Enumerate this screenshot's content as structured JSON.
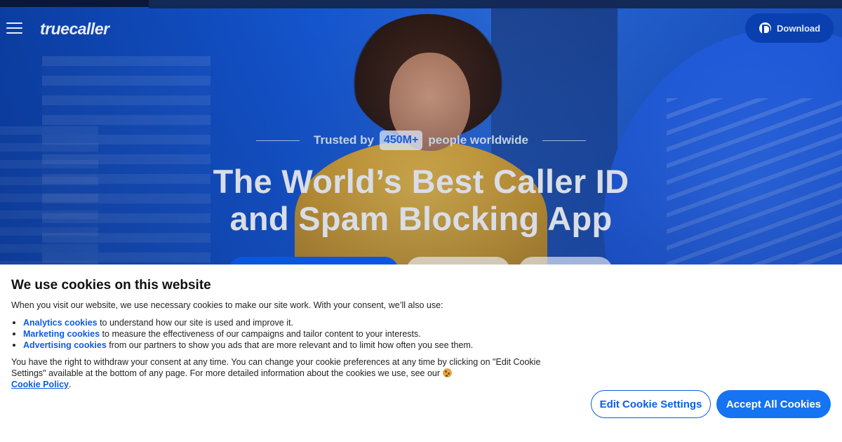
{
  "header": {
    "logo_text": "truecaller",
    "download_label": "Download"
  },
  "hero": {
    "trusted_prefix": "Trusted by",
    "trusted_count": "450M+",
    "trusted_suffix": "people worldwide",
    "headline_line1": "The World’s Best Caller ID",
    "headline_line2": "and Spam Blocking App"
  },
  "cookie_banner": {
    "title": "We use cookies on this website",
    "intro": "When you visit our website, we use necessary cookies to make our site work. With your consent, we’ll also use:",
    "items": [
      {
        "link": "Analytics cookies",
        "text": " to understand how our site is used and improve it."
      },
      {
        "link": "Marketing cookies",
        "text": " to measure the effectiveness of our campaigns and tailor content to your interests."
      },
      {
        "link": "Advertising cookies",
        "text": " from our partners to show you ads that are more relevant and to limit how often you see them."
      }
    ],
    "rights_text": "You have the right to withdraw your consent at any time. You can change your cookie preferences at any time by clicking on \"Edit Cookie Settings\" available at the bottom of any page. For more detailed information about the cookies we use, see our",
    "policy_link": "Cookie Policy",
    "policy_suffix": ".",
    "edit_label": "Edit Cookie Settings",
    "accept_label": "Accept All Cookies"
  },
  "colors": {
    "brand_blue": "#0d5ce6",
    "accept_blue": "#1673f2",
    "hero_blue": "#1558d6"
  }
}
